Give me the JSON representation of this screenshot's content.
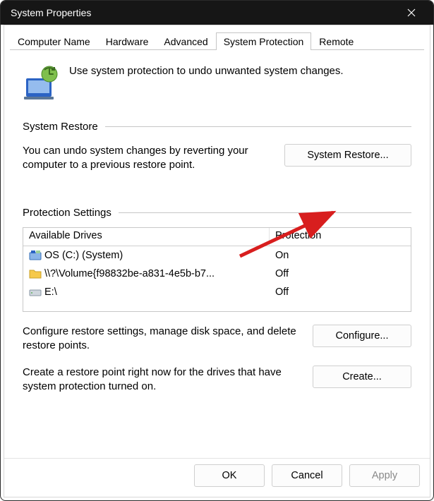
{
  "title": "System Properties",
  "tabs": [
    "Computer Name",
    "Hardware",
    "Advanced",
    "System Protection",
    "Remote"
  ],
  "activeTab": "System Protection",
  "intro": "Use system protection to undo unwanted system changes.",
  "systemRestore": {
    "groupLabel": "System Restore",
    "description": "You can undo system changes by reverting your computer to a previous restore point.",
    "button": "System Restore..."
  },
  "protectionSettings": {
    "groupLabel": "Protection Settings",
    "headers": {
      "drive": "Available Drives",
      "protection": "Protection"
    },
    "drives": [
      {
        "icon": "os",
        "name": "OS (C:) (System)",
        "protection": "On"
      },
      {
        "icon": "folder",
        "name": "\\\\?\\Volume{f98832be-a831-4e5b-b7...",
        "protection": "Off"
      },
      {
        "icon": "disk",
        "name": "E:\\",
        "protection": "Off"
      }
    ],
    "configure": {
      "description": "Configure restore settings, manage disk space, and delete restore points.",
      "button": "Configure..."
    },
    "create": {
      "description": "Create a restore point right now for the drives that have system protection turned on.",
      "button": "Create..."
    }
  },
  "buttons": {
    "ok": "OK",
    "cancel": "Cancel",
    "apply": "Apply"
  }
}
